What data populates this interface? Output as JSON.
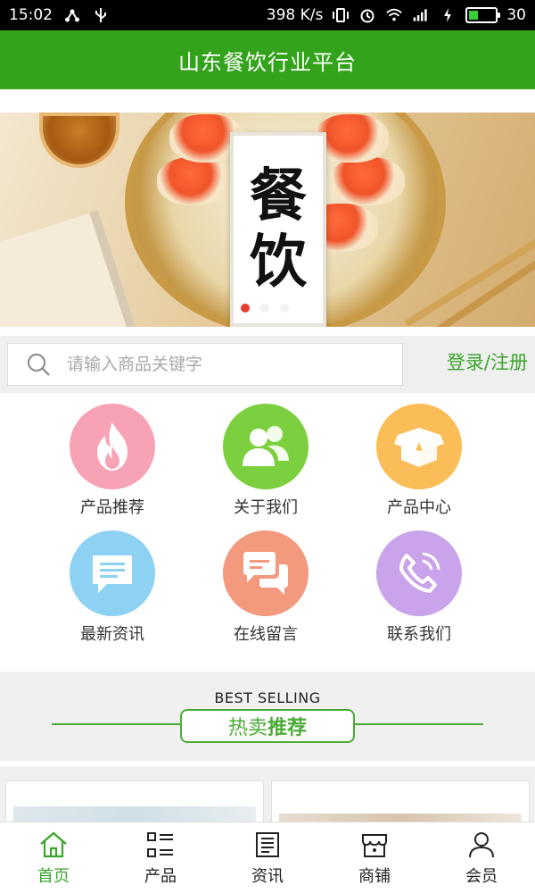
{
  "status_bar": {
    "time": "15:02",
    "network_speed": "398 K/s",
    "battery_level": "30"
  },
  "header": {
    "title": "山东餐饮行业平台"
  },
  "banner": {
    "card_chars": [
      "餐",
      "饮"
    ],
    "slide_count": 3,
    "active_slide": 0
  },
  "search": {
    "placeholder": "请输入商品关键字",
    "login_label": "登录/注册"
  },
  "categories": [
    {
      "label": "产品推荐",
      "icon": "fire-icon",
      "color": "#f7a3b5"
    },
    {
      "label": "关于我们",
      "icon": "users-icon",
      "color": "#7cd03f"
    },
    {
      "label": "产品中心",
      "icon": "box-icon",
      "color": "#fbbd58"
    },
    {
      "label": "最新资讯",
      "icon": "message-icon",
      "color": "#8dd2f3"
    },
    {
      "label": "在线留言",
      "icon": "chat-icon",
      "color": "#f39a7e"
    },
    {
      "label": "联系我们",
      "icon": "phone-icon",
      "color": "#c9a4ea"
    }
  ],
  "best_selling": {
    "en_title": "BEST SELLING",
    "cn_title_part1": "热卖",
    "cn_title_part2": "推荐"
  },
  "bottom_nav": [
    {
      "label": "首页",
      "icon": "home-icon",
      "active": true
    },
    {
      "label": "产品",
      "icon": "grid-list-icon",
      "active": false
    },
    {
      "label": "资讯",
      "icon": "news-icon",
      "active": false
    },
    {
      "label": "商铺",
      "icon": "shop-icon",
      "active": false
    },
    {
      "label": "会员",
      "icon": "user-icon",
      "active": false
    }
  ],
  "colors": {
    "brand_green": "#33a31b",
    "accent_green": "#3aa52c"
  }
}
